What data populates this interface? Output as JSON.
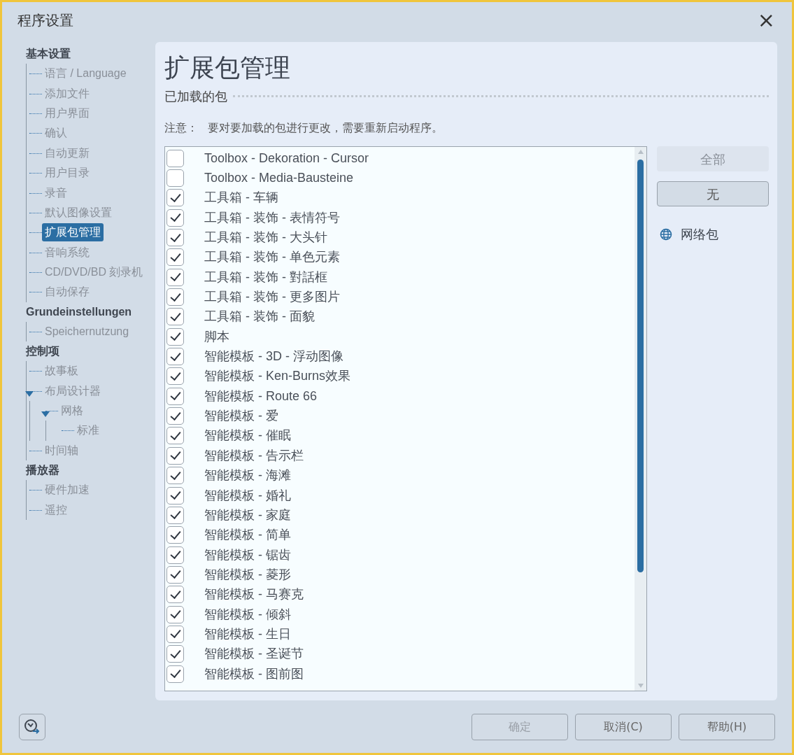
{
  "window": {
    "title": "程序设置",
    "close": "×"
  },
  "sidebar": {
    "groups": [
      {
        "title": "基本设置",
        "items": [
          {
            "label": "语言 / Language",
            "selected": false
          },
          {
            "label": "添加文件",
            "selected": false
          },
          {
            "label": "用户界面",
            "selected": false
          },
          {
            "label": "确认",
            "selected": false
          },
          {
            "label": "自动更新",
            "selected": false
          },
          {
            "label": "用户目录",
            "selected": false
          },
          {
            "label": "录音",
            "selected": false
          },
          {
            "label": "默认图像设置",
            "selected": false
          },
          {
            "label": "扩展包管理",
            "selected": true
          },
          {
            "label": "音响系统",
            "selected": false
          },
          {
            "label": "CD/DVD/BD 刻录机",
            "selected": false
          },
          {
            "label": "自动保存",
            "selected": false
          }
        ]
      },
      {
        "title": "Grundeinstellungen",
        "items": [
          {
            "label": "Speichernutzung",
            "selected": false
          }
        ]
      },
      {
        "title": "控制项",
        "items": [
          {
            "label": "故事板",
            "selected": false
          },
          {
            "label": "布局设计器",
            "selected": false,
            "expanded": true,
            "children": [
              {
                "label": "网格",
                "selected": false,
                "expanded": true,
                "children": [
                  {
                    "label": "标准",
                    "selected": false
                  }
                ]
              }
            ]
          },
          {
            "label": "时间轴",
            "selected": false
          }
        ]
      },
      {
        "title": "播放器",
        "items": [
          {
            "label": "硬件加速",
            "selected": false
          },
          {
            "label": "遥控",
            "selected": false
          }
        ]
      }
    ]
  },
  "page": {
    "title": "扩展包管理",
    "section": "已加载的包",
    "note_label": "注意：",
    "note": "要对要加载的包进行更改，需要重新启动程序。"
  },
  "packages": [
    {
      "label": "Toolbox - Dekoration - Cursor",
      "checked": false
    },
    {
      "label": "Toolbox - Media-Bausteine",
      "checked": false
    },
    {
      "label": "工具箱 - 车辆",
      "checked": true
    },
    {
      "label": "工具箱 - 装饰 - 表情符号",
      "checked": true
    },
    {
      "label": "工具箱 - 装饰 - 大头针",
      "checked": true
    },
    {
      "label": "工具箱 - 装饰 - 单色元素",
      "checked": true
    },
    {
      "label": "工具箱 - 装饰 - 對話框",
      "checked": true
    },
    {
      "label": "工具箱 - 装饰 - 更多图片",
      "checked": true
    },
    {
      "label": "工具箱 - 装饰 - 面貌",
      "checked": true
    },
    {
      "label": "脚本",
      "checked": true
    },
    {
      "label": "智能模板 - 3D - 浮动图像",
      "checked": true
    },
    {
      "label": "智能模板 - Ken-Burns效果",
      "checked": true
    },
    {
      "label": "智能模板 - Route 66",
      "checked": true
    },
    {
      "label": "智能模板 - 爱",
      "checked": true
    },
    {
      "label": "智能模板 - 催眠",
      "checked": true
    },
    {
      "label": "智能模板 - 告示栏",
      "checked": true
    },
    {
      "label": "智能模板 - 海滩",
      "checked": true
    },
    {
      "label": "智能模板 - 婚礼",
      "checked": true
    },
    {
      "label": "智能模板 - 家庭",
      "checked": true
    },
    {
      "label": "智能模板 - 简单",
      "checked": true
    },
    {
      "label": "智能模板 - 锯齿",
      "checked": true
    },
    {
      "label": "智能模板 - 菱形",
      "checked": true
    },
    {
      "label": "智能模板 - 马赛克",
      "checked": true
    },
    {
      "label": "智能模板 - 倾斜",
      "checked": true
    },
    {
      "label": "智能模板 - 生日",
      "checked": true
    },
    {
      "label": "智能模板 - 圣诞节",
      "checked": true
    },
    {
      "label": "智能模板 - 图前图",
      "checked": true
    }
  ],
  "side_buttons": [
    {
      "label": "全部",
      "disabled": true
    },
    {
      "label": "无",
      "disabled": false
    }
  ],
  "web_link": "网络包",
  "footer_buttons": [
    {
      "label": "确定",
      "disabled": true
    },
    {
      "label": "取消(C)",
      "disabled": false
    },
    {
      "label": "帮助(H)",
      "disabled": false
    }
  ]
}
